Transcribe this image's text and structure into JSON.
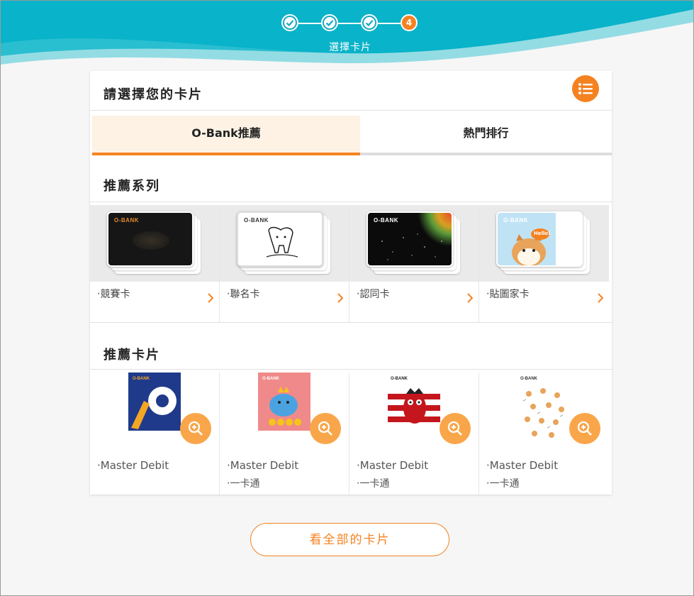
{
  "stepper": {
    "steps": [
      "done",
      "done",
      "done",
      "4"
    ],
    "active_step": "4",
    "current_title": "選擇卡片"
  },
  "panel": {
    "title": "請選擇您的卡片",
    "menu_icon": "list-icon"
  },
  "tabs": [
    {
      "label": "O-Bank推薦",
      "active": true
    },
    {
      "label": "熱門排行",
      "active": false
    }
  ],
  "series_section": {
    "title": "推薦系列",
    "items": [
      {
        "label": "‧競賽卡",
        "brand": "O-BANK"
      },
      {
        "label": "‧聯名卡",
        "brand": "O-BANK"
      },
      {
        "label": "‧認同卡",
        "brand": "O-BANK"
      },
      {
        "label": "‧貼圖家卡",
        "brand": "O-BANK",
        "card_text": "Hello!"
      }
    ]
  },
  "recommend_section": {
    "title": "推薦卡片",
    "items": [
      {
        "line1": "‧Master Debit",
        "line2": ""
      },
      {
        "line1": "‧Master Debit",
        "line2": "‧一卡通"
      },
      {
        "line1": "‧Master Debit",
        "line2": "‧一卡通"
      },
      {
        "line1": "‧Master Debit",
        "line2": "‧一卡通"
      }
    ]
  },
  "view_all_button": "看全部的卡片",
  "colors": {
    "accent": "#f58220",
    "teal": "#00b4c8",
    "tab_active_bg": "#fdf2e4",
    "zoom_button": "#f9a64a"
  }
}
